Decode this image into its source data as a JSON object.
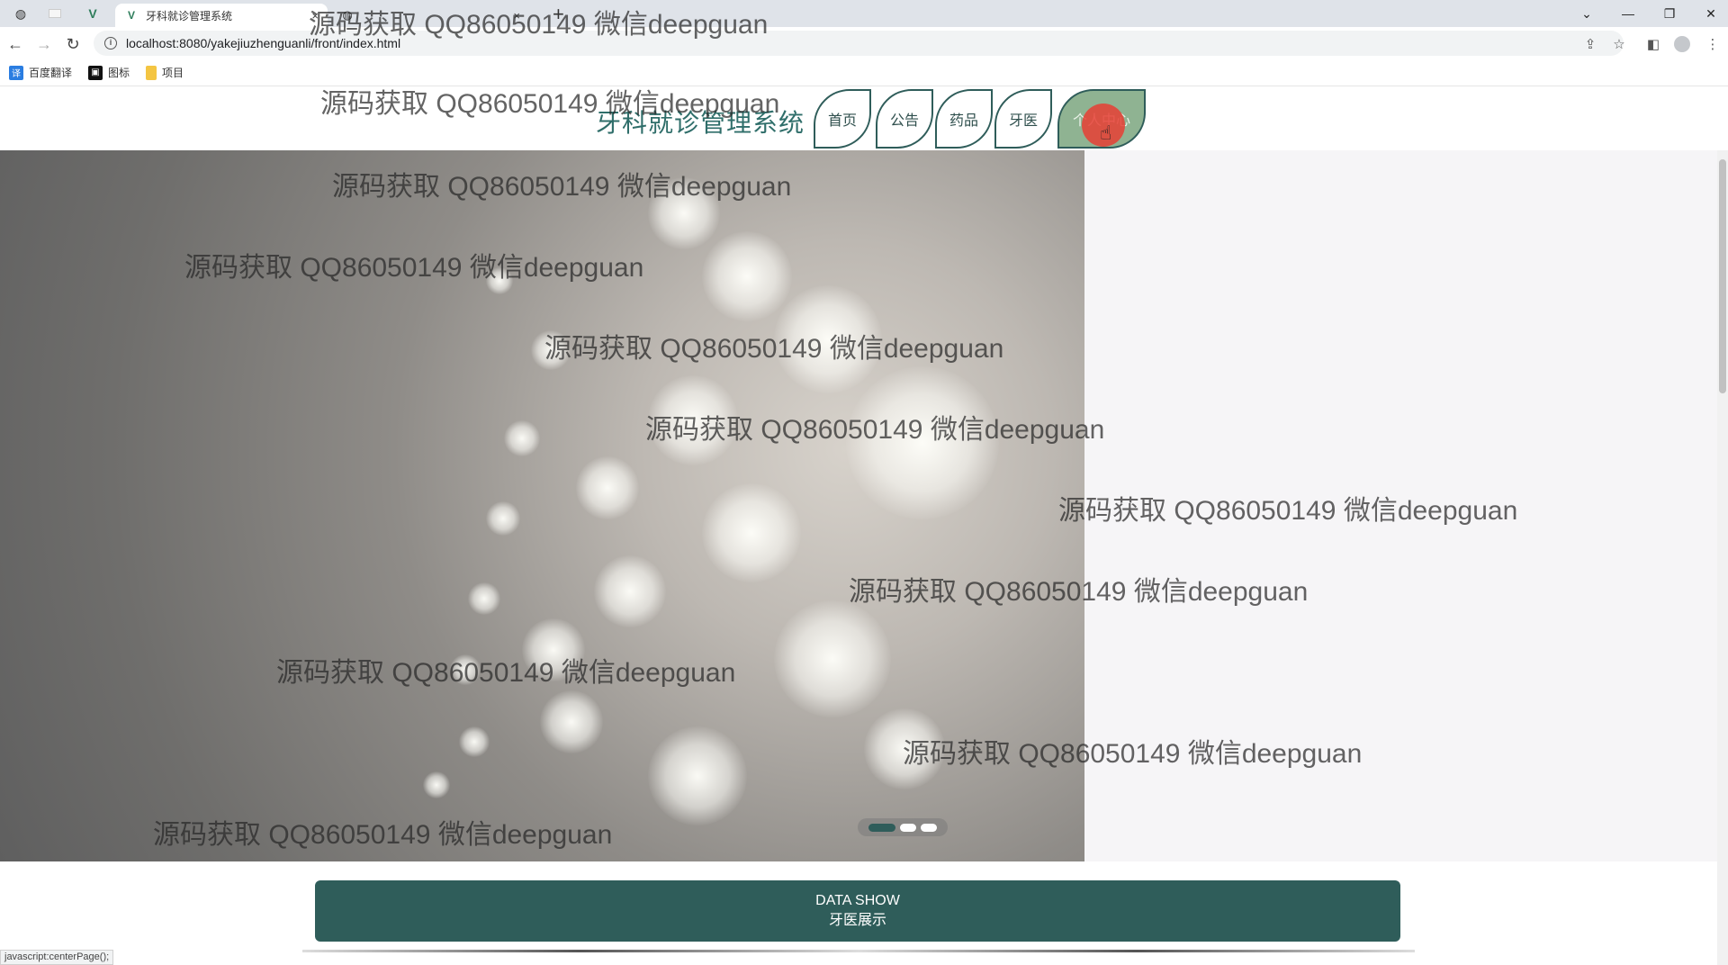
{
  "browser": {
    "tabs": [
      {
        "title": "牙科就诊管理系统",
        "close": "×"
      },
      {
        "title": "",
        "close": "×"
      }
    ],
    "new_tab": "+",
    "url": "localhost:8080/yakejiuzhenguanli/front/index.html",
    "bookmarks": [
      "百度翻译",
      "图标",
      "项目"
    ],
    "status_text": "javascript:centerPage();"
  },
  "site": {
    "title": "牙科就诊管理系统",
    "nav": [
      "首页",
      "公告",
      "药品",
      "牙医",
      "个人中心"
    ]
  },
  "banner": {
    "slide_count": 3,
    "active_slide": 1
  },
  "data_show": {
    "title_en": "DATA SHOW",
    "title_cn": "牙医展示"
  },
  "watermark_text": "源码获取 QQ86050149 微信deepguan",
  "colors": {
    "brand": "#2f5d5a",
    "nav_active_bg": "#8fb392",
    "title_text": "#2f6e6a"
  }
}
